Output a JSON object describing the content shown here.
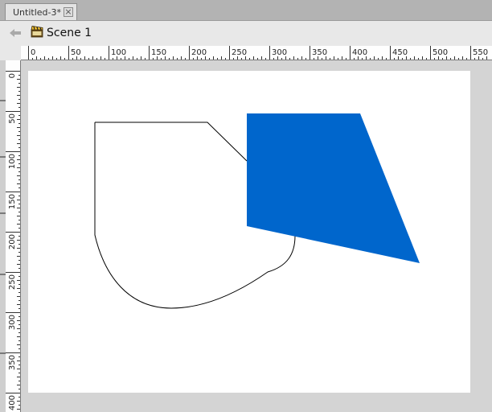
{
  "document": {
    "tab_title": "Untitled-3*",
    "close_symbol": "×"
  },
  "editbar": {
    "scene_label": "Scene 1"
  },
  "ruler": {
    "horizontal_labels": [
      "0",
      "50",
      "100",
      "150",
      "200",
      "250",
      "300",
      "350",
      "400",
      "450",
      "500",
      "550"
    ],
    "vertical_labels": [
      "0",
      "50",
      "100",
      "150",
      "200",
      "250",
      "300",
      "350",
      "400"
    ]
  },
  "colors": {
    "fill_shape": "#0066cc",
    "stroke": "#000000",
    "stage": "#ffffff",
    "pasteboard": "#d4d4d4"
  },
  "icons": [
    "back-arrow-icon",
    "scene-clapper-icon",
    "close-icon"
  ]
}
